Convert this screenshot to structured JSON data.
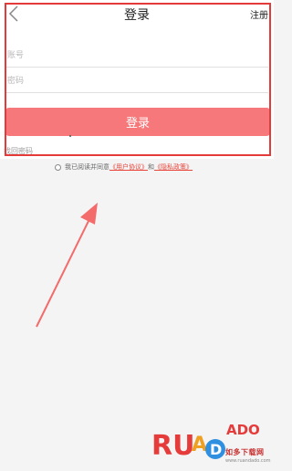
{
  "header": {
    "title": "登录",
    "register_label": "注册"
  },
  "form": {
    "account_placeholder": "账号",
    "password_placeholder": "密码",
    "login_label": "登录",
    "forgot_label": "找回密码"
  },
  "agreement": {
    "prefix": "我已阅读并同意",
    "user_agreement": "《用户协议》",
    "conjunction": "和",
    "privacy_policy": "《隐私政策》"
  },
  "watermark": {
    "logo": "RUANDADO",
    "subtitle": "如多下载网",
    "url": "www.ruandado.com"
  },
  "colors": {
    "accent": "#f6787a",
    "annotation": "#e53a3a",
    "link": "#e8443a"
  }
}
